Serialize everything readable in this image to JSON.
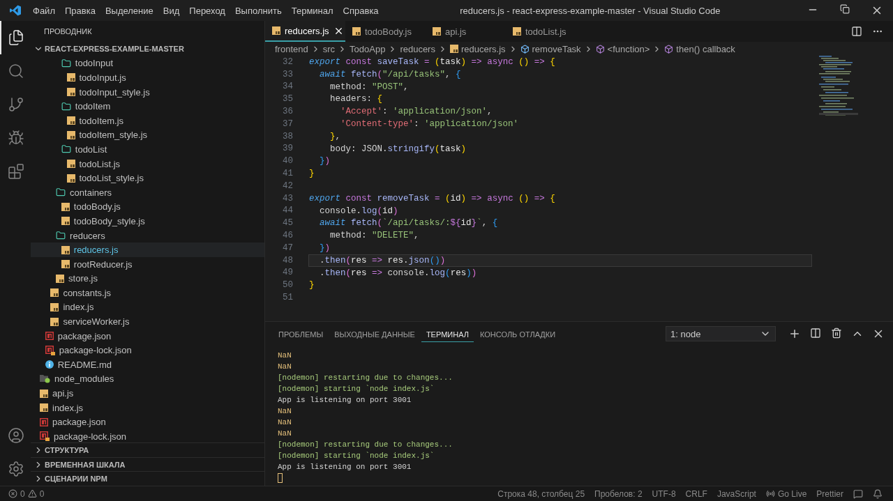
{
  "window": {
    "title": "reducers.js - react-express-example-master - Visual Studio Code"
  },
  "menu": [
    "Файл",
    "Правка",
    "Выделение",
    "Вид",
    "Переход",
    "Выполнить",
    "Терминал",
    "Справка"
  ],
  "activity": {
    "top": [
      {
        "kind": "files",
        "selected": true
      },
      {
        "kind": "search",
        "selected": false
      },
      {
        "kind": "git",
        "selected": false
      },
      {
        "kind": "debug",
        "selected": false
      },
      {
        "kind": "extensions",
        "selected": false
      }
    ],
    "bottom": [
      {
        "kind": "account",
        "selected": false
      },
      {
        "kind": "settings",
        "selected": false
      }
    ]
  },
  "explorer": {
    "title": "ПРОВОДНИК",
    "root": {
      "label": "REACT-EXPRESS-EXAMPLE-MASTER",
      "expanded": true,
      "children": [
        {
          "children": [
            {
              "children": [
                {
                  "children": [
                    {
                      "children": [
                        {
                          "label": "todoInput",
                          "kind": "folder",
                          "selected": false,
                          "children": [
                            {
                              "label": "todoInput.js",
                              "kind": "js",
                              "selected": false
                            },
                            {
                              "label": "todoInput_style.js",
                              "kind": "js",
                              "selected": false
                            }
                          ]
                        },
                        {
                          "label": "todoItem",
                          "kind": "folder",
                          "selected": false,
                          "children": [
                            {
                              "label": "todoItem.js",
                              "kind": "js",
                              "selected": false
                            },
                            {
                              "label": "todoItem_style.js",
                              "kind": "js",
                              "selected": false
                            }
                          ]
                        },
                        {
                          "label": "todoList",
                          "kind": "folder",
                          "selected": false,
                          "children": [
                            {
                              "label": "todoList.js",
                              "kind": "js",
                              "selected": false
                            },
                            {
                              "label": "todoList_style.js",
                              "kind": "js",
                              "selected": false
                            }
                          ]
                        }
                      ]
                    },
                    {
                      "label": "containers",
                      "kind": "folder",
                      "selected": false,
                      "children": [
                        {
                          "label": "todoBody.js",
                          "kind": "js",
                          "selected": false
                        },
                        {
                          "label": "todoBody_style.js",
                          "kind": "js",
                          "selected": false
                        }
                      ]
                    },
                    {
                      "label": "reducers",
                      "kind": "folder",
                      "selected": false,
                      "children": [
                        {
                          "label": "reducers.js",
                          "kind": "js",
                          "selected": true
                        },
                        {
                          "label": "rootReducer.js",
                          "kind": "js",
                          "selected": false
                        }
                      ]
                    },
                    {
                      "label": "store.js",
                      "kind": "js",
                      "selected": false
                    }
                  ]
                },
                {
                  "label": "constants.js",
                  "kind": "js",
                  "selected": false
                },
                {
                  "label": "index.js",
                  "kind": "js",
                  "selected": false
                },
                {
                  "label": "serviceWorker.js",
                  "kind": "js",
                  "selected": false
                }
              ]
            },
            {
              "label": "package.json",
              "kind": "json",
              "selected": false
            },
            {
              "label": "package-lock.json",
              "kind": "lock",
              "selected": false
            },
            {
              "label": "README.md",
              "kind": "info",
              "selected": false
            }
          ]
        },
        {
          "label": "node_modules",
          "kind": "modules",
          "selected": false
        },
        {
          "label": "api.js",
          "kind": "js",
          "selected": false
        },
        {
          "label": "index.js",
          "kind": "js",
          "selected": false
        },
        {
          "label": "package.json",
          "kind": "json",
          "selected": false
        },
        {
          "label": "package-lock.json",
          "kind": "lock",
          "selected": false
        }
      ]
    },
    "sections": [
      {
        "label": "СТРУКТУРА",
        "expanded": false
      },
      {
        "label": "ВРЕМЕННАЯ ШКАЛА",
        "expanded": false
      },
      {
        "label": "СЦЕНАРИИ NPM",
        "expanded": false
      }
    ]
  },
  "tabs": [
    {
      "label": "reducers.js",
      "selected": true
    },
    {
      "label": "todoBody.js",
      "selected": false
    },
    {
      "label": "api.js",
      "selected": false
    },
    {
      "label": "todoList.js",
      "selected": false
    }
  ],
  "breadcrumbs": [
    {
      "label": "frontend",
      "kind": "folder"
    },
    {
      "label": "src",
      "kind": "folder"
    },
    {
      "label": "TodoApp",
      "kind": "folder"
    },
    {
      "label": "reducers",
      "kind": "folder"
    },
    {
      "label": "reducers.js",
      "kind": "js"
    },
    {
      "label": "removeTask",
      "kind": "variable"
    },
    {
      "label": "<function>",
      "kind": "method"
    },
    {
      "label": "then() callback",
      "kind": "method"
    }
  ],
  "editor": {
    "lines": [
      {
        "number": "32",
        "current": false,
        "tokens": [
          {
            "kind": "kw",
            "text": "export "
          },
          {
            "kind": "st",
            "text": "const "
          },
          {
            "kind": "fn",
            "text": "saveTask "
          },
          {
            "kind": "st",
            "text": "= "
          },
          {
            "kind": "b1",
            "text": "("
          },
          {
            "kind": "pr",
            "text": "task"
          },
          {
            "kind": "b1",
            "text": ") "
          },
          {
            "kind": "st",
            "text": "=> "
          },
          {
            "kind": "st",
            "text": "async "
          },
          {
            "kind": "b1",
            "text": "() "
          },
          {
            "kind": "st",
            "text": "=> "
          },
          {
            "kind": "b1",
            "text": "{"
          }
        ]
      },
      {
        "number": "33",
        "current": false,
        "tokens": [
          {
            "kind": "kw",
            "text": "  await "
          },
          {
            "kind": "fn",
            "text": "fetch"
          },
          {
            "kind": "b2",
            "text": "("
          },
          {
            "kind": "str",
            "text": "\"/api/tasks\""
          },
          {
            "kind": "pl",
            "text": ", "
          },
          {
            "kind": "b3",
            "text": "{"
          }
        ]
      },
      {
        "number": "34",
        "current": false,
        "tokens": [
          {
            "kind": "pl",
            "text": "    method: "
          },
          {
            "kind": "str",
            "text": "\"POST\""
          },
          {
            "kind": "pl",
            "text": ","
          }
        ]
      },
      {
        "number": "35",
        "current": false,
        "tokens": [
          {
            "kind": "pl",
            "text": "    headers: "
          },
          {
            "kind": "b1",
            "text": "{"
          }
        ]
      },
      {
        "number": "36",
        "current": false,
        "tokens": [
          {
            "kind": "key",
            "text": "      'Accept'"
          },
          {
            "kind": "pl",
            "text": ": "
          },
          {
            "kind": "str",
            "text": "'application/json'"
          },
          {
            "kind": "pl",
            "text": ","
          }
        ]
      },
      {
        "number": "37",
        "current": false,
        "tokens": [
          {
            "kind": "key",
            "text": "      'Content-type'"
          },
          {
            "kind": "pl",
            "text": ": "
          },
          {
            "kind": "str",
            "text": "'application/json'"
          }
        ]
      },
      {
        "number": "38",
        "current": false,
        "tokens": [
          {
            "kind": "b1",
            "text": "    }"
          },
          {
            "kind": "pl",
            "text": ","
          }
        ]
      },
      {
        "number": "39",
        "current": false,
        "tokens": [
          {
            "kind": "pl",
            "text": "    body: JSON."
          },
          {
            "kind": "fn",
            "text": "stringify"
          },
          {
            "kind": "b1",
            "text": "("
          },
          {
            "kind": "pr",
            "text": "task"
          },
          {
            "kind": "b1",
            "text": ")"
          }
        ]
      },
      {
        "number": "40",
        "current": false,
        "tokens": [
          {
            "kind": "b3",
            "text": "  }"
          },
          {
            "kind": "b2",
            "text": ")"
          }
        ]
      },
      {
        "number": "41",
        "current": false,
        "tokens": [
          {
            "kind": "b1",
            "text": "}"
          }
        ]
      },
      {
        "number": "42",
        "current": false
      },
      {
        "number": "43",
        "current": false,
        "tokens": [
          {
            "kind": "kw",
            "text": "export "
          },
          {
            "kind": "st",
            "text": "const "
          },
          {
            "kind": "fn",
            "text": "removeTask "
          },
          {
            "kind": "st",
            "text": "= "
          },
          {
            "kind": "b1",
            "text": "("
          },
          {
            "kind": "pr",
            "text": "id"
          },
          {
            "kind": "b1",
            "text": ") "
          },
          {
            "kind": "st",
            "text": "=> "
          },
          {
            "kind": "st",
            "text": "async "
          },
          {
            "kind": "b1",
            "text": "() "
          },
          {
            "kind": "st",
            "text": "=> "
          },
          {
            "kind": "b1",
            "text": "{"
          }
        ]
      },
      {
        "number": "44",
        "current": false,
        "tokens": [
          {
            "kind": "pl",
            "text": "  console."
          },
          {
            "kind": "fn",
            "text": "log"
          },
          {
            "kind": "b2",
            "text": "("
          },
          {
            "kind": "pr",
            "text": "id"
          },
          {
            "kind": "b2",
            "text": ")"
          }
        ]
      },
      {
        "number": "45",
        "current": false,
        "tokens": [
          {
            "kind": "kw",
            "text": "  await "
          },
          {
            "kind": "fn",
            "text": "fetch"
          },
          {
            "kind": "b2",
            "text": "("
          },
          {
            "kind": "str",
            "text": "`/api/tasks/:"
          },
          {
            "kind": "st",
            "text": "${"
          },
          {
            "kind": "pr",
            "text": "id"
          },
          {
            "kind": "st",
            "text": "}"
          },
          {
            "kind": "str",
            "text": "`"
          },
          {
            "kind": "pl",
            "text": ", "
          },
          {
            "kind": "b3",
            "text": "{"
          }
        ]
      },
      {
        "number": "46",
        "current": false,
        "tokens": [
          {
            "kind": "pl",
            "text": "    method: "
          },
          {
            "kind": "str",
            "text": "\"DELETE\""
          },
          {
            "kind": "pl",
            "text": ","
          }
        ]
      },
      {
        "number": "47",
        "current": false,
        "tokens": [
          {
            "kind": "b3",
            "text": "  }"
          },
          {
            "kind": "b2",
            "text": ")"
          }
        ]
      },
      {
        "number": "48",
        "current": true,
        "tokens": [
          {
            "kind": "pl",
            "text": "  ."
          },
          {
            "kind": "fn",
            "text": "then"
          },
          {
            "kind": "b2",
            "text": "("
          },
          {
            "kind": "pr",
            "text": "res "
          },
          {
            "kind": "st",
            "text": "=> "
          },
          {
            "kind": "pr",
            "text": "res"
          },
          {
            "kind": "pl",
            "text": "."
          },
          {
            "kind": "fn",
            "text": "json"
          },
          {
            "kind": "b3",
            "text": "()"
          },
          {
            "kind": "b2",
            "text": ")"
          }
        ]
      },
      {
        "number": "49",
        "current": false,
        "tokens": [
          {
            "kind": "pl",
            "text": "  ."
          },
          {
            "kind": "fn",
            "text": "then"
          },
          {
            "kind": "b2",
            "text": "("
          },
          {
            "kind": "pr",
            "text": "res "
          },
          {
            "kind": "st",
            "text": "=> "
          },
          {
            "kind": "pl",
            "text": "console."
          },
          {
            "kind": "fn",
            "text": "log"
          },
          {
            "kind": "b3",
            "text": "("
          },
          {
            "kind": "pr",
            "text": "res"
          },
          {
            "kind": "b3",
            "text": ")"
          },
          {
            "kind": "b2",
            "text": ")"
          }
        ]
      },
      {
        "number": "50",
        "current": false,
        "tokens": [
          {
            "kind": "b1",
            "text": "}"
          }
        ]
      },
      {
        "number": "51",
        "current": false
      }
    ]
  },
  "panel": {
    "tabs": [
      {
        "label": "ПРОБЛЕМЫ",
        "selected": false
      },
      {
        "label": "ВЫХОДНЫЕ ДАННЫЕ",
        "selected": false
      },
      {
        "label": "ТЕРМИНАЛ",
        "selected": true
      },
      {
        "label": "КОНСОЛЬ ОТЛАДКИ",
        "selected": false
      }
    ],
    "terminal_select": "1: node",
    "lines": [
      {
        "kind": "warn",
        "text": "NaN"
      },
      {
        "kind": "warn",
        "text": "NaN"
      },
      {
        "kind": "info",
        "text": "[nodemon] restarting due to changes..."
      },
      {
        "kind": "info",
        "text": "[nodemon] starting `node index.js`"
      },
      {
        "kind": "plain",
        "text": "App is listening on port 3001"
      },
      {
        "kind": "warn",
        "text": "NaN"
      },
      {
        "kind": "warn",
        "text": "NaN"
      },
      {
        "kind": "warn",
        "text": "NaN"
      },
      {
        "kind": "info",
        "text": "[nodemon] restarting due to changes..."
      },
      {
        "kind": "info",
        "text": "[nodemon] starting `node index.js`"
      },
      {
        "kind": "plain",
        "text": "App is listening on port 3001"
      }
    ]
  },
  "status_bar": {
    "errors": "0",
    "warnings": "0",
    "items": [
      {
        "kind": "text",
        "text": "Строка 48, столбец 25"
      },
      {
        "kind": "text",
        "text": "Пробелов: 2"
      },
      {
        "kind": "text",
        "text": "UTF-8"
      },
      {
        "kind": "text",
        "text": "CRLF"
      },
      {
        "kind": "text",
        "text": "JavaScript"
      },
      {
        "kind": "live",
        "text": "Go Live"
      },
      {
        "kind": "text",
        "text": "Prettier"
      }
    ]
  }
}
